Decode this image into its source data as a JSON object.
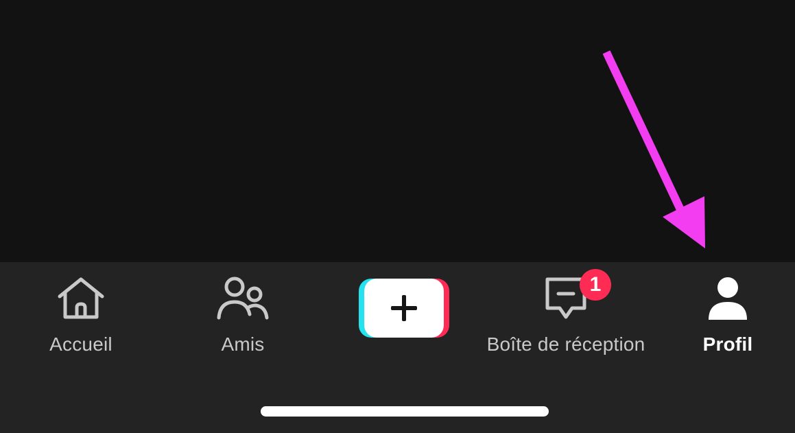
{
  "tabs": {
    "home": {
      "label": "Accueil",
      "icon": "home-icon"
    },
    "friends": {
      "label": "Amis",
      "icon": "friends-icon"
    },
    "create": {
      "icon": "plus-icon"
    },
    "inbox": {
      "label": "Boîte de réception",
      "icon": "inbox-icon",
      "badge": "1"
    },
    "profile": {
      "label": "Profil",
      "icon": "profile-icon",
      "active": true
    }
  },
  "colors": {
    "background": "#121212",
    "tab_bar": "#232323",
    "inactive": "#c9c9c9",
    "active": "#ffffff",
    "badge": "#fe2c55",
    "create_cyan": "#25e2ee",
    "create_pink": "#fe2c55",
    "annotation_arrow": "#f23ef0"
  }
}
